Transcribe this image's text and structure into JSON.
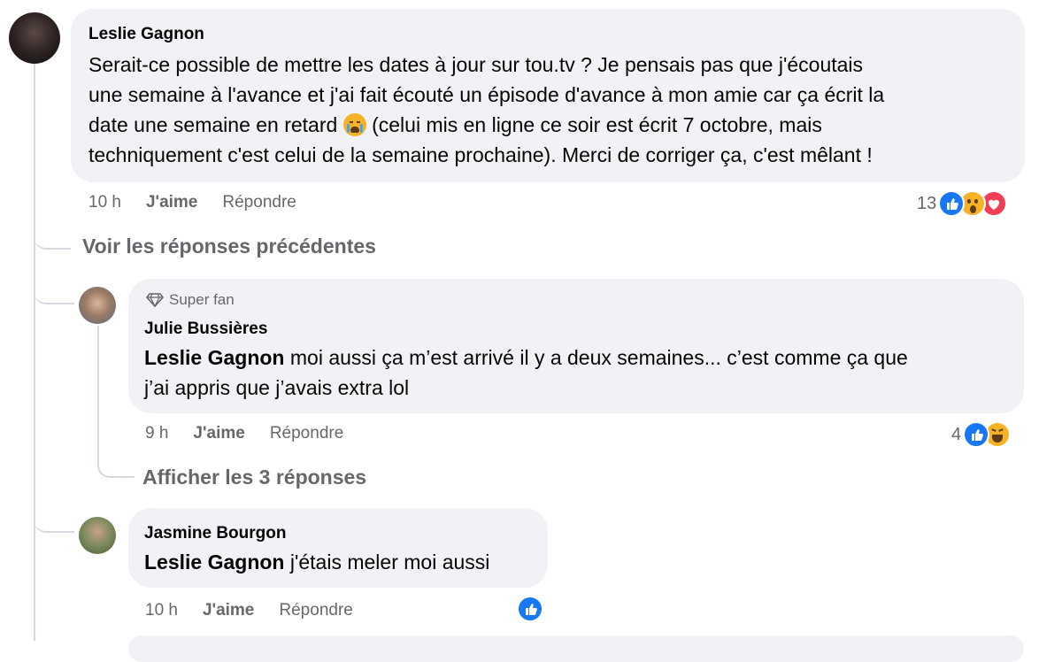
{
  "comment_main": {
    "author": "Leslie Gagnon",
    "text_line1": "Serait-ce possible de mettre les dates à jour sur tou.tv ? Je pensais pas que j'écoutais",
    "text_line2": "une semaine à l'avance et j'ai fait écouté un épisode d'avance à mon amie car ça écrit la",
    "text_line3a": "date une semaine en retard ",
    "text_line3b": " (celui mis en ligne ce soir est écrit 7 octobre, mais",
    "text_line4": "techniquement c'est celui de la semaine prochaine). Merci de corriger ça, c'est mêlant !",
    "time": "10 h",
    "like_label": "J'aime",
    "reply_label": "Répondre",
    "reaction_count": "13"
  },
  "previous_replies_label": "Voir les réponses précédentes",
  "reply_julie": {
    "badge": "Super fan",
    "author": "Julie Bussières",
    "mention": "Leslie Gagnon",
    "text_line1": " moi aussi ça m’est arrivé il y a deux semaines... c’est comme ça que",
    "text_line2": "j’ai appris que j’avais extra lol",
    "time": "9 h",
    "like_label": "J'aime",
    "reply_label": "Répondre",
    "reaction_count": "4"
  },
  "show_replies_label": "Afficher les 3 réponses",
  "reply_jasmine": {
    "author": "Jasmine Bourgon",
    "mention": "Leslie Gagnon",
    "text": " j'étais meler moi aussi",
    "time": "10 h",
    "like_label": "J'aime",
    "reply_label": "Répondre"
  },
  "colors": {
    "like_blue": "#1877f2",
    "love_red": "#f33e58",
    "haha_yellow": "#f7b125",
    "bubble_gray": "#f0f2f5",
    "meta_gray": "#65676b"
  },
  "icons": [
    "like-reaction-icon",
    "wow-reaction-icon",
    "love-reaction-icon",
    "haha-reaction-icon",
    "crying-emoji-icon",
    "diamond-icon"
  ]
}
